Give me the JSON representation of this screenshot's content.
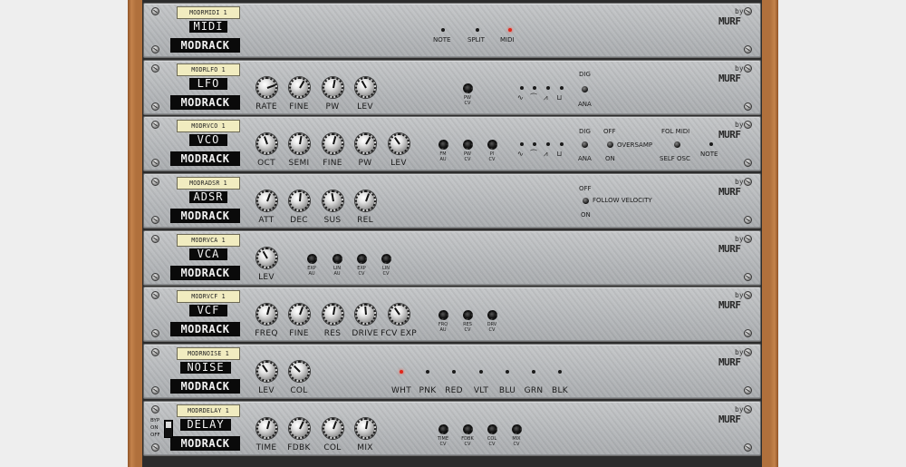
{
  "modules": [
    {
      "tag": "MODRMIDI 1",
      "name": "MIDI",
      "brand": "MODRACK",
      "by": "by",
      "logo": "MURF",
      "leds": [
        {
          "label": "NOTE",
          "on": false
        },
        {
          "label": "SPLIT",
          "on": false
        },
        {
          "label": "MIDI",
          "on": true
        }
      ]
    },
    {
      "tag": "MODRLFO 1",
      "name": "LFO",
      "brand": "MODRACK",
      "by": "by",
      "logo": "MURF",
      "knobs": [
        {
          "label": "RATE",
          "angle": -110
        },
        {
          "label": "FINE",
          "angle": -150
        },
        {
          "label": "PW",
          "angle": -170
        },
        {
          "label": "LEV",
          "angle": 150
        }
      ],
      "small_knobs": [
        {
          "label": "PW\nCV"
        }
      ],
      "waves": [
        "∿",
        "⏜",
        "⩘",
        "⊔"
      ],
      "switch": {
        "top": "DIG",
        "bottom": "ANA"
      }
    },
    {
      "tag": "MODRVCO 1",
      "name": "VCO",
      "brand": "MODRACK",
      "by": "by",
      "logo": "MURF",
      "knobs": [
        {
          "label": "OCT",
          "angle": 160
        },
        {
          "label": "SEMI",
          "angle": -170
        },
        {
          "label": "FINE",
          "angle": -165
        },
        {
          "label": "PW",
          "angle": -150
        },
        {
          "label": "LEV",
          "angle": 145
        }
      ],
      "small_knobs": [
        {
          "label": "FM\nAU"
        },
        {
          "label": "PW\nCV"
        },
        {
          "label": "PI\nCV"
        }
      ],
      "waves": [
        "∿",
        "⏜",
        "⩘",
        "⊔"
      ],
      "switches": [
        {
          "top": "DIG",
          "bottom": "ANA"
        },
        {
          "top": "OFF",
          "mid": "OVERSAMP",
          "bottom": "ON"
        },
        {
          "top": "FOL MIDI",
          "bottom": "SELF OSC",
          "right": "NOTE"
        }
      ]
    },
    {
      "tag": "MODRADSR 1",
      "name": "ADSR",
      "brand": "MODRACK",
      "by": "by",
      "logo": "MURF",
      "knobs": [
        {
          "label": "ATT",
          "angle": -160
        },
        {
          "label": "DEC",
          "angle": -175
        },
        {
          "label": "SUS",
          "angle": 170
        },
        {
          "label": "REL",
          "angle": -160
        }
      ],
      "follow": {
        "top": "OFF",
        "mid": "FOLLOW VELOCITY",
        "bottom": "ON"
      }
    },
    {
      "tag": "MODRVCA 1",
      "name": "VCA",
      "brand": "MODRACK",
      "by": "by",
      "logo": "MURF",
      "knobs": [
        {
          "label": "LEV",
          "angle": 150
        }
      ],
      "small_knobs": [
        {
          "label": "EXP\nAU"
        },
        {
          "label": "LIN\nAU"
        },
        {
          "label": "EXP\nCV"
        },
        {
          "label": "LIN\nCV"
        }
      ]
    },
    {
      "tag": "MODRVCF 1",
      "name": "VCF",
      "brand": "MODRACK",
      "by": "by",
      "logo": "MURF",
      "knobs": [
        {
          "label": "FREQ",
          "angle": -165
        },
        {
          "label": "FINE",
          "angle": -160
        },
        {
          "label": "RES",
          "angle": -170
        },
        {
          "label": "DRIVE",
          "angle": 175
        },
        {
          "label": "FCV EXP",
          "angle": 145
        }
      ],
      "small_knobs": [
        {
          "label": "FRQ\nAU"
        },
        {
          "label": "RES\nCV"
        },
        {
          "label": "DRV\nCV"
        }
      ]
    },
    {
      "tag": "MODRNOISE 1",
      "name": "NOISE",
      "brand": "MODRACK",
      "by": "by",
      "logo": "MURF",
      "knobs": [
        {
          "label": "LEV",
          "angle": 145
        },
        {
          "label": "COL",
          "angle": 135
        }
      ],
      "leds": [
        {
          "label": "WHT",
          "on": true
        },
        {
          "label": "PNK",
          "on": false
        },
        {
          "label": "RED",
          "on": false
        },
        {
          "label": "VLT",
          "on": false
        },
        {
          "label": "BLU",
          "on": false
        },
        {
          "label": "GRN",
          "on": false
        },
        {
          "label": "BLK",
          "on": false
        }
      ]
    },
    {
      "tag": "MODRDELAY 1",
      "name": "DELAY",
      "brand": "MODRACK",
      "by": "by",
      "logo": "MURF",
      "bypass": {
        "byp": "BYP",
        "on": "ON",
        "off": "OFF"
      },
      "knobs": [
        {
          "label": "TIME",
          "angle": -165
        },
        {
          "label": "FDBK",
          "angle": -155
        },
        {
          "label": "COL",
          "angle": -160
        },
        {
          "label": "MIX",
          "angle": -170
        }
      ],
      "small_knobs": [
        {
          "label": "TIME\nCV"
        },
        {
          "label": "FDBK\nCV"
        },
        {
          "label": "COL\nCV"
        },
        {
          "label": "MIX\nCV"
        }
      ]
    }
  ]
}
